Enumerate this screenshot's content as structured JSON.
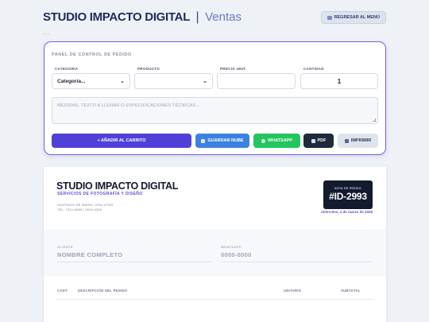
{
  "header": {
    "brand": "STUDIO IMPACTO DIGITAL",
    "separator": "|",
    "section": "Ventas",
    "back_button": "REGRESAR AL MENÚ",
    "ellipsis": "..."
  },
  "panel": {
    "title": "PANEL DE CONTROL DE PEDIDO",
    "fields": {
      "category_label": "CATEGORÍA",
      "category_value": "Categoría...",
      "product_label": "PRODUCTO",
      "product_value": "",
      "unit_price_label": "PRECIO UNIT.",
      "unit_price_value": "",
      "quantity_label": "CANTIDAD",
      "quantity_value": "1"
    },
    "notes_placeholder": "MEDIDAS, TEXTO A LLENAR O ESPECIFICACIONES TÉCNICAS...",
    "buttons": {
      "add": "+ AÑADIR AL CARRITO",
      "save_cloud": "GUARDAR NUBE",
      "whatsapp": "WHATSAPP",
      "pdf": "PDF",
      "print": "IMPRIMIR"
    },
    "colors": {
      "accent": "#6c63e8",
      "add": "#5040d8",
      "cloud": "#3b82e0",
      "whatsapp": "#22c55e",
      "pdf": "#1e293b"
    }
  },
  "document": {
    "title": "STUDIO IMPACTO DIGITAL",
    "subtitle": "SERVICIOS DE FOTOGRAFÍA Y DISEÑO",
    "address_line1": "SANTIAGO DE MARÍA, USULUTÁN",
    "address_line2": "TEL: 7241-8668 | 2624-4345",
    "order_label": "NOTA DE PEDIDO",
    "order_id": "#ID-2993",
    "date": "miércoles, 4 de marzo de 2026",
    "client_label": "CLIENTE",
    "client_value": "NOMBRE COMPLETO",
    "whatsapp_label": "WHATSAPP",
    "whatsapp_value": "0000-0000",
    "table_headers": {
      "qty": "CANT.",
      "description": "DESCRIPCIÓN DEL PEDIDO",
      "unit": "UNITARIO",
      "subtotal": "SUBTOTAL"
    }
  }
}
